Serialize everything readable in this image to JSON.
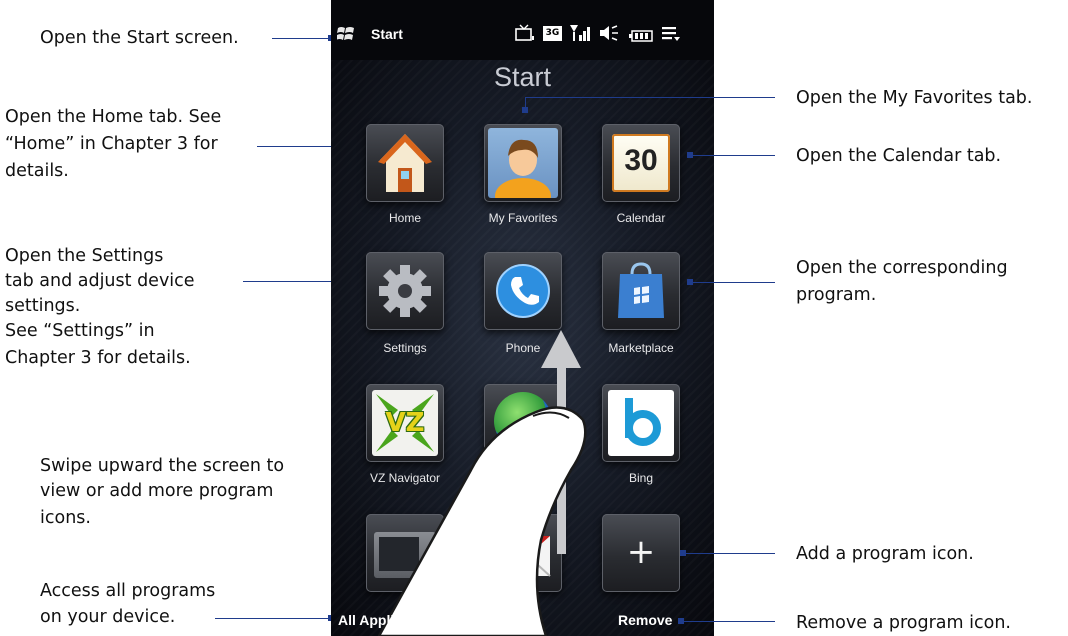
{
  "annotations": {
    "start_screen": "Open the Start screen.",
    "home_1": "Open the Home tab. See",
    "home_2": "“Home” in Chapter 3 for",
    "home_3": "details.",
    "settings_1": "Open the Settings",
    "settings_2": "tab and adjust device",
    "settings_3": "settings.",
    "settings_4": "See “Settings” in",
    "settings_5": "Chapter 3 for details.",
    "swipe_1": "Swipe upward the screen to",
    "swipe_2": "view or add more program",
    "swipe_3": "icons.",
    "allapps_1": "Access all programs",
    "allapps_2": "on your device.",
    "favorites": "Open the My Favorites tab.",
    "calendar": "Open the Calendar tab.",
    "program_1": "Open the corresponding",
    "program_2": "program.",
    "add": "Add a program icon.",
    "remove": "Remove a program icon."
  },
  "phone": {
    "status_start": "Start",
    "title": "Start",
    "tiles": [
      {
        "label": "Home"
      },
      {
        "label": "My Favorites"
      },
      {
        "label": "Calendar",
        "value": "30"
      },
      {
        "label": "Settings"
      },
      {
        "label": "Phone"
      },
      {
        "label": "Marketplace"
      },
      {
        "label": "VZ Navigator",
        "badge": "VZ"
      },
      {
        "label": ""
      },
      {
        "label": "Bing"
      }
    ],
    "add_symbol": "+",
    "softkeys": {
      "left": "All Applications",
      "right": "Remove"
    }
  },
  "colors": {
    "accent_line": "#1f3c8c",
    "phone_bg": "#06070b"
  }
}
